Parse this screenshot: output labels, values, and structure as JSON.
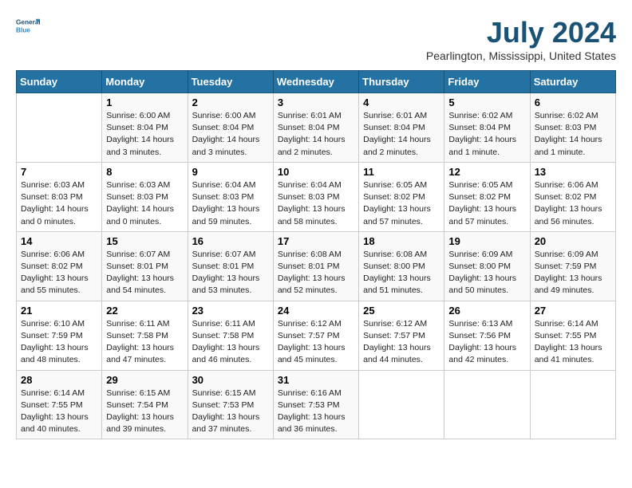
{
  "header": {
    "logo_line1": "General",
    "logo_line2": "Blue",
    "title": "July 2024",
    "subtitle": "Pearlington, Mississippi, United States"
  },
  "weekdays": [
    "Sunday",
    "Monday",
    "Tuesday",
    "Wednesday",
    "Thursday",
    "Friday",
    "Saturday"
  ],
  "weeks": [
    [
      {
        "day": "",
        "info": ""
      },
      {
        "day": "1",
        "info": "Sunrise: 6:00 AM\nSunset: 8:04 PM\nDaylight: 14 hours\nand 3 minutes."
      },
      {
        "day": "2",
        "info": "Sunrise: 6:00 AM\nSunset: 8:04 PM\nDaylight: 14 hours\nand 3 minutes."
      },
      {
        "day": "3",
        "info": "Sunrise: 6:01 AM\nSunset: 8:04 PM\nDaylight: 14 hours\nand 2 minutes."
      },
      {
        "day": "4",
        "info": "Sunrise: 6:01 AM\nSunset: 8:04 PM\nDaylight: 14 hours\nand 2 minutes."
      },
      {
        "day": "5",
        "info": "Sunrise: 6:02 AM\nSunset: 8:04 PM\nDaylight: 14 hours\nand 1 minute."
      },
      {
        "day": "6",
        "info": "Sunrise: 6:02 AM\nSunset: 8:03 PM\nDaylight: 14 hours\nand 1 minute."
      }
    ],
    [
      {
        "day": "7",
        "info": "Sunrise: 6:03 AM\nSunset: 8:03 PM\nDaylight: 14 hours\nand 0 minutes."
      },
      {
        "day": "8",
        "info": "Sunrise: 6:03 AM\nSunset: 8:03 PM\nDaylight: 14 hours\nand 0 minutes."
      },
      {
        "day": "9",
        "info": "Sunrise: 6:04 AM\nSunset: 8:03 PM\nDaylight: 13 hours\nand 59 minutes."
      },
      {
        "day": "10",
        "info": "Sunrise: 6:04 AM\nSunset: 8:03 PM\nDaylight: 13 hours\nand 58 minutes."
      },
      {
        "day": "11",
        "info": "Sunrise: 6:05 AM\nSunset: 8:02 PM\nDaylight: 13 hours\nand 57 minutes."
      },
      {
        "day": "12",
        "info": "Sunrise: 6:05 AM\nSunset: 8:02 PM\nDaylight: 13 hours\nand 57 minutes."
      },
      {
        "day": "13",
        "info": "Sunrise: 6:06 AM\nSunset: 8:02 PM\nDaylight: 13 hours\nand 56 minutes."
      }
    ],
    [
      {
        "day": "14",
        "info": "Sunrise: 6:06 AM\nSunset: 8:02 PM\nDaylight: 13 hours\nand 55 minutes."
      },
      {
        "day": "15",
        "info": "Sunrise: 6:07 AM\nSunset: 8:01 PM\nDaylight: 13 hours\nand 54 minutes."
      },
      {
        "day": "16",
        "info": "Sunrise: 6:07 AM\nSunset: 8:01 PM\nDaylight: 13 hours\nand 53 minutes."
      },
      {
        "day": "17",
        "info": "Sunrise: 6:08 AM\nSunset: 8:01 PM\nDaylight: 13 hours\nand 52 minutes."
      },
      {
        "day": "18",
        "info": "Sunrise: 6:08 AM\nSunset: 8:00 PM\nDaylight: 13 hours\nand 51 minutes."
      },
      {
        "day": "19",
        "info": "Sunrise: 6:09 AM\nSunset: 8:00 PM\nDaylight: 13 hours\nand 50 minutes."
      },
      {
        "day": "20",
        "info": "Sunrise: 6:09 AM\nSunset: 7:59 PM\nDaylight: 13 hours\nand 49 minutes."
      }
    ],
    [
      {
        "day": "21",
        "info": "Sunrise: 6:10 AM\nSunset: 7:59 PM\nDaylight: 13 hours\nand 48 minutes."
      },
      {
        "day": "22",
        "info": "Sunrise: 6:11 AM\nSunset: 7:58 PM\nDaylight: 13 hours\nand 47 minutes."
      },
      {
        "day": "23",
        "info": "Sunrise: 6:11 AM\nSunset: 7:58 PM\nDaylight: 13 hours\nand 46 minutes."
      },
      {
        "day": "24",
        "info": "Sunrise: 6:12 AM\nSunset: 7:57 PM\nDaylight: 13 hours\nand 45 minutes."
      },
      {
        "day": "25",
        "info": "Sunrise: 6:12 AM\nSunset: 7:57 PM\nDaylight: 13 hours\nand 44 minutes."
      },
      {
        "day": "26",
        "info": "Sunrise: 6:13 AM\nSunset: 7:56 PM\nDaylight: 13 hours\nand 42 minutes."
      },
      {
        "day": "27",
        "info": "Sunrise: 6:14 AM\nSunset: 7:55 PM\nDaylight: 13 hours\nand 41 minutes."
      }
    ],
    [
      {
        "day": "28",
        "info": "Sunrise: 6:14 AM\nSunset: 7:55 PM\nDaylight: 13 hours\nand 40 minutes."
      },
      {
        "day": "29",
        "info": "Sunrise: 6:15 AM\nSunset: 7:54 PM\nDaylight: 13 hours\nand 39 minutes."
      },
      {
        "day": "30",
        "info": "Sunrise: 6:15 AM\nSunset: 7:53 PM\nDaylight: 13 hours\nand 37 minutes."
      },
      {
        "day": "31",
        "info": "Sunrise: 6:16 AM\nSunset: 7:53 PM\nDaylight: 13 hours\nand 36 minutes."
      },
      {
        "day": "",
        "info": ""
      },
      {
        "day": "",
        "info": ""
      },
      {
        "day": "",
        "info": ""
      }
    ]
  ]
}
